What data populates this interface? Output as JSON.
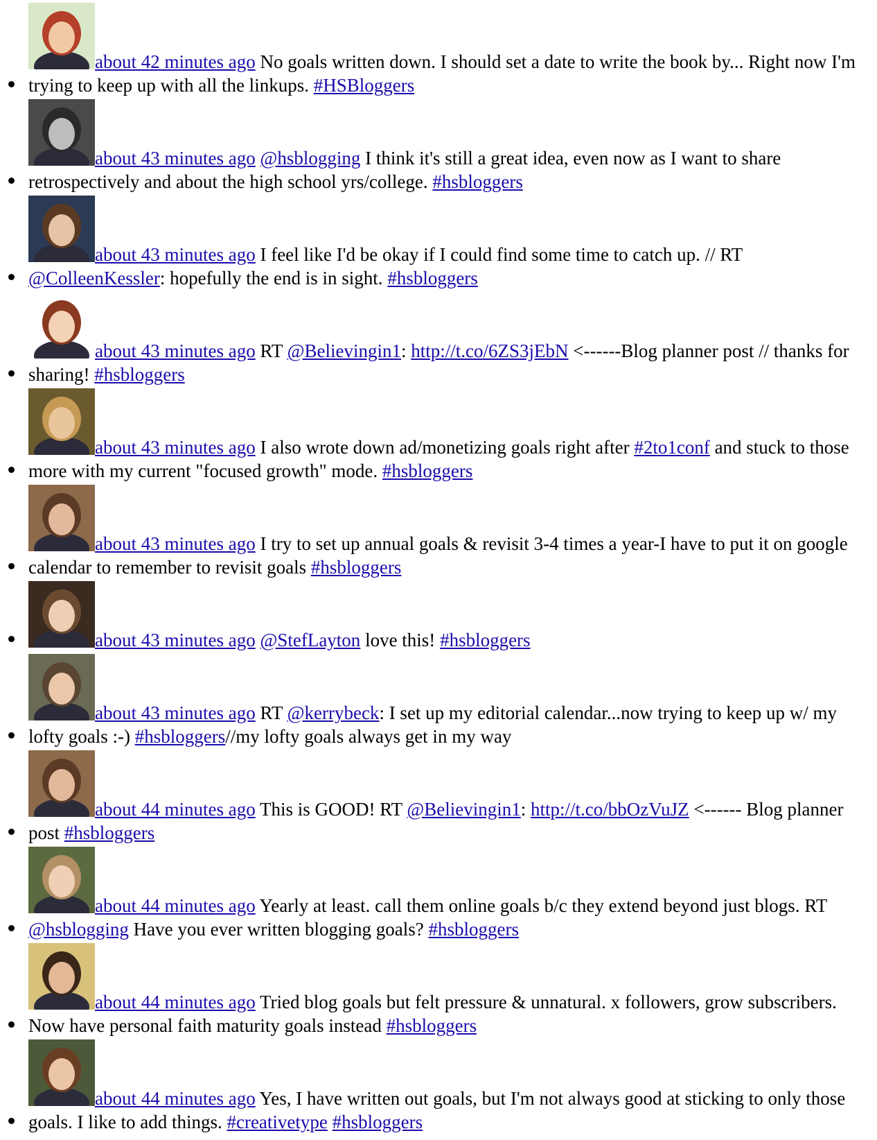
{
  "tweets": [
    {
      "avatar": "avatar-cartoon-red-hair",
      "avatar_bg": "#d9e8c8",
      "time": "about 42 minutes ago",
      "parts": [
        {
          "t": "text",
          "v": " No goals written down. I should set a date to write the book by... Right now I'm trying to keep up with all the linkups. "
        },
        {
          "t": "link",
          "v": "#HSBloggers"
        }
      ]
    },
    {
      "avatar": "avatar-black-white-photo",
      "avatar_bg": "#4a4a4a",
      "time": "about 43 minutes ago",
      "parts": [
        {
          "t": "text",
          "v": " "
        },
        {
          "t": "link",
          "v": "@hsblogging"
        },
        {
          "t": "text",
          "v": " I think it's still a great idea, even now as I want to share retrospectively and about the high school yrs/college. "
        },
        {
          "t": "link",
          "v": "#hsbloggers"
        }
      ]
    },
    {
      "avatar": "avatar-woman-brown-hair",
      "avatar_bg": "#2b3a55",
      "time": "about 43 minutes ago",
      "parts": [
        {
          "t": "text",
          "v": " I feel like I'd be okay if I could find some time to catch up. // RT "
        },
        {
          "t": "link",
          "v": "@ColleenKessler"
        },
        {
          "t": "text",
          "v": ": hopefully the end is in sight. "
        },
        {
          "t": "link",
          "v": "#hsbloggers"
        }
      ]
    },
    {
      "avatar": "avatar-cartoon-glasses",
      "avatar_bg": "#ffffff",
      "time": "about 43 minutes ago",
      "parts": [
        {
          "t": "text",
          "v": " RT "
        },
        {
          "t": "link",
          "v": "@Believingin1"
        },
        {
          "t": "text",
          "v": ": "
        },
        {
          "t": "link",
          "v": "http://t.co/6ZS3jEbN"
        },
        {
          "t": "text",
          "v": " <------Blog planner post // thanks for sharing! "
        },
        {
          "t": "link",
          "v": "#hsbloggers"
        }
      ]
    },
    {
      "avatar": "avatar-woman-blonde",
      "avatar_bg": "#6b5a2e",
      "time": "about 43 minutes ago",
      "parts": [
        {
          "t": "text",
          "v": " I also wrote down ad/monetizing goals right after "
        },
        {
          "t": "link",
          "v": "#2to1conf"
        },
        {
          "t": "text",
          "v": " and stuck to those more with my current \"focused growth\" mode. "
        },
        {
          "t": "link",
          "v": "#hsbloggers"
        }
      ]
    },
    {
      "avatar": "avatar-woman-glasses",
      "avatar_bg": "#8c6a4a",
      "time": "about 43 minutes ago",
      "parts": [
        {
          "t": "text",
          "v": " I try to set up annual goals & revisit 3-4 times a year-I have to put it on google calendar to remember to revisit goals "
        },
        {
          "t": "link",
          "v": "#hsbloggers"
        }
      ]
    },
    {
      "avatar": "avatar-woman-smiling",
      "avatar_bg": "#3a2a20",
      "time": "about 43 minutes ago",
      "parts": [
        {
          "t": "text",
          "v": " "
        },
        {
          "t": "link",
          "v": "@StefLayton"
        },
        {
          "t": "text",
          "v": " love this! "
        },
        {
          "t": "link",
          "v": "#hsbloggers"
        }
      ]
    },
    {
      "avatar": "avatar-woman-bangs",
      "avatar_bg": "#6a6a55",
      "time": "about 43 minutes ago",
      "parts": [
        {
          "t": "text",
          "v": " RT "
        },
        {
          "t": "link",
          "v": "@kerrybeck"
        },
        {
          "t": "text",
          "v": ": I set up my editorial calendar...now trying to keep up w/ my lofty goals :-) "
        },
        {
          "t": "link",
          "v": "#hsbloggers"
        },
        {
          "t": "text",
          "v": "//my lofty goals always get in my way"
        }
      ]
    },
    {
      "avatar": "avatar-woman-glasses",
      "avatar_bg": "#8c6a4a",
      "time": "about 44 minutes ago",
      "parts": [
        {
          "t": "text",
          "v": " This is GOOD! RT "
        },
        {
          "t": "link",
          "v": "@Believingin1"
        },
        {
          "t": "text",
          "v": ": "
        },
        {
          "t": "link",
          "v": "http://t.co/bbOzVuJZ"
        },
        {
          "t": "text",
          "v": " <------ Blog planner post "
        },
        {
          "t": "link",
          "v": "#hsbloggers"
        }
      ]
    },
    {
      "avatar": "avatar-woman-outdoors",
      "avatar_bg": "#5c6a40",
      "time": "about 44 minutes ago",
      "parts": [
        {
          "t": "text",
          "v": " Yearly at least. call them online goals b/c they extend beyond just blogs. RT "
        },
        {
          "t": "link",
          "v": "@hsblogging"
        },
        {
          "t": "text",
          "v": " Have you ever written blogging goals? "
        },
        {
          "t": "link",
          "v": "#hsbloggers"
        }
      ]
    },
    {
      "avatar": "avatar-woman-dark-hair",
      "avatar_bg": "#d8c27a",
      "time": "about 44 minutes ago",
      "parts": [
        {
          "t": "text",
          "v": " Tried blog goals but felt pressure & unnatural. x followers, grow subscribers. Now have personal faith maturity goals instead "
        },
        {
          "t": "link",
          "v": "#hsbloggers"
        }
      ]
    },
    {
      "avatar": "avatar-woman-glasses-green",
      "avatar_bg": "#4d5a3a",
      "time": "about 44 minutes ago",
      "parts": [
        {
          "t": "text",
          "v": " Yes, I have written out goals, but I'm not always good at sticking to only those goals. I like to add things. "
        },
        {
          "t": "link",
          "v": "#creativetype"
        },
        {
          "t": "text",
          "v": " "
        },
        {
          "t": "link",
          "v": "#hsbloggers"
        }
      ]
    }
  ]
}
